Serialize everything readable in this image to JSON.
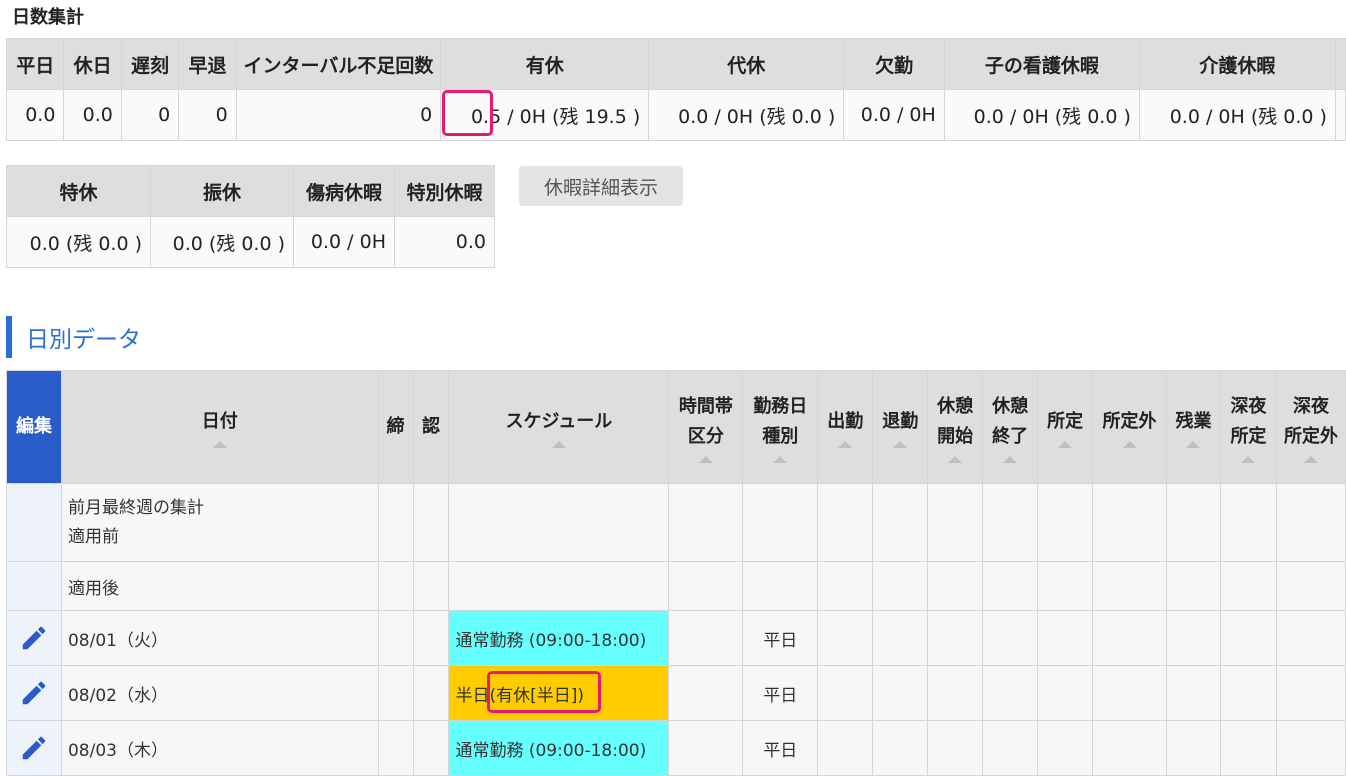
{
  "summary": {
    "title": "日数集計",
    "headers1": [
      "平日",
      "休日",
      "遅刻",
      "早退",
      "インターバル不足回数",
      "有休",
      "代休",
      "欠勤",
      "子の看護休暇",
      "介護休暇"
    ],
    "values1": [
      "0.0",
      "0.0",
      "0",
      "0",
      "0",
      "0.5 / 0H (残 19.5 )",
      "0.0 / 0H (残 0.0 )",
      "0.0 / 0H",
      "0.0 / 0H (残 0.0 )",
      "0.0 / 0H (残 0.0 )"
    ],
    "headers2": [
      "特休",
      "振休",
      "傷病休暇",
      "特別休暇"
    ],
    "values2": [
      "0.0 (残 0.0 )",
      "0.0 (残 0.0 )",
      "0.0 / 0H",
      "0.0"
    ],
    "detail_button": "休暇詳細表示"
  },
  "daily": {
    "title": "日別データ",
    "headers": {
      "edit": "編集",
      "date": "日付",
      "close": "締",
      "approve": "認",
      "schedule": "スケジュール",
      "time_zone": [
        "時間帯",
        "区分"
      ],
      "work_day_type": [
        "勤務日",
        "種別"
      ],
      "clock_in": "出勤",
      "clock_out": "退勤",
      "break_start": [
        "休憩",
        "開始"
      ],
      "break_end": [
        "休憩",
        "終了"
      ],
      "scheduled": "所定",
      "non_scheduled": "所定外",
      "overtime": "残業",
      "late_night_scheduled": [
        "深夜",
        "所定"
      ],
      "late_night_non_scheduled": [
        "深夜",
        "所定外"
      ]
    },
    "summary_rows": [
      {
        "label_line1": "前月最終週の集計",
        "label_line2": "適用前"
      },
      {
        "label_line1": "適用後"
      }
    ],
    "rows": [
      {
        "date": "08/01（火）",
        "schedule": "通常勤務 (09:00-18:00)",
        "schedule_color": "#65ffff",
        "work_day_type": "平日"
      },
      {
        "date": "08/02（水）",
        "schedule": "半日(有休[半日])",
        "schedule_color": "#ffcc00",
        "work_day_type": "平日"
      },
      {
        "date": "08/03（木）",
        "schedule": "通常勤務 (09:00-18:00)",
        "schedule_color": "#65ffff",
        "work_day_type": "平日"
      }
    ]
  },
  "colors": {
    "accent": "#2a6fd6",
    "edit_header": "#2a5cc9",
    "highlight": "#e8196e"
  }
}
